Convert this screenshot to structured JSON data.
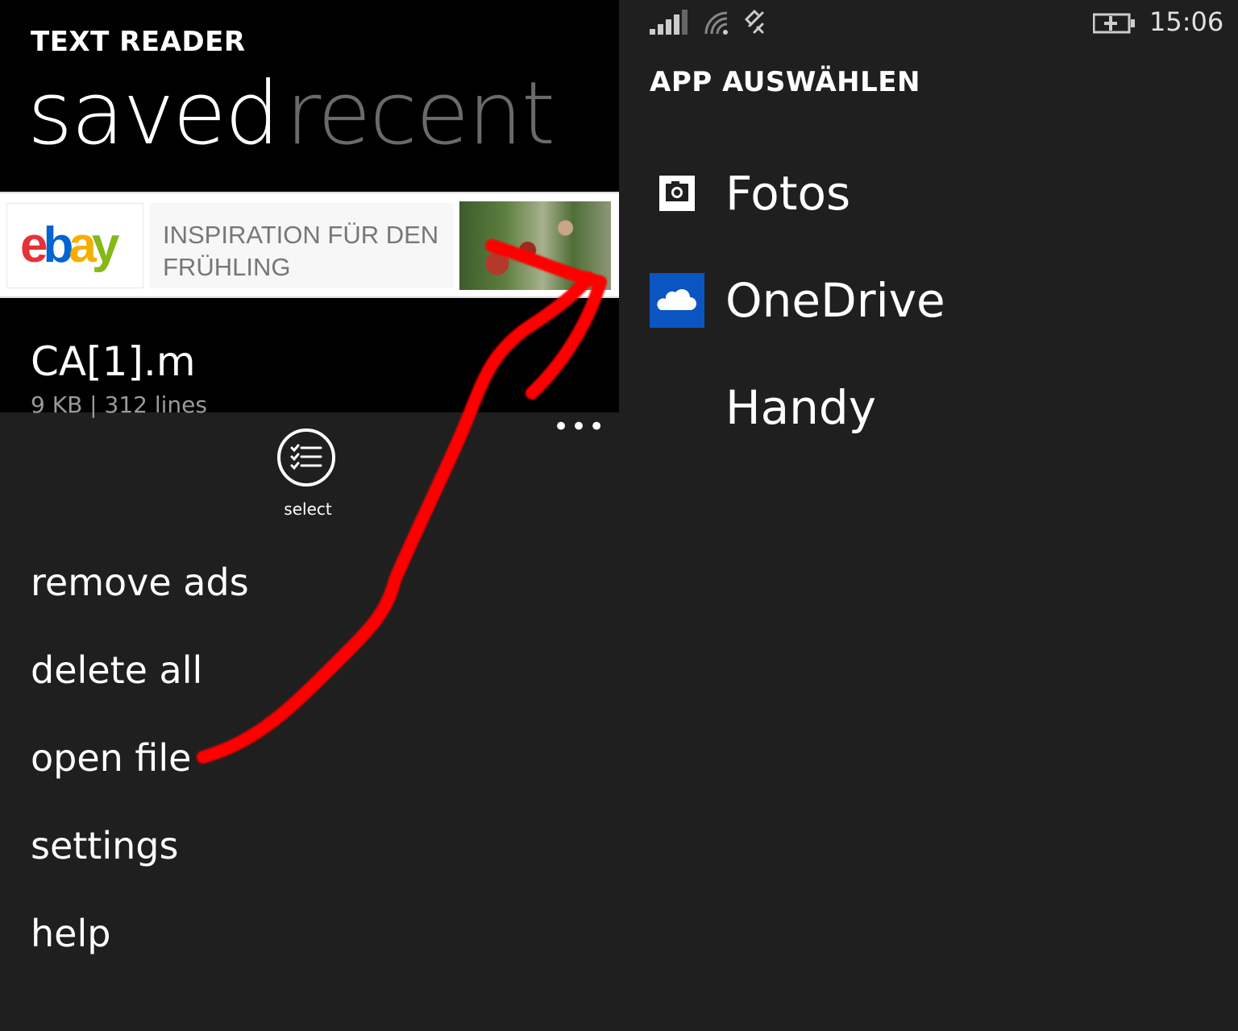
{
  "left_app": {
    "title": "TEXT READER",
    "pivots": {
      "active": "saved",
      "inactive": "recent"
    },
    "ad": {
      "logo": {
        "e": "e",
        "b": "b",
        "a": "a",
        "y": "y"
      },
      "text": "INSPIRATION FÜR DEN FRÜHLING"
    },
    "file": {
      "name": "CA[1].m",
      "meta": "9 KB | 312 lines"
    },
    "appbar": {
      "select_label": "select",
      "more": "•••"
    },
    "menu": [
      "remove ads",
      "delete all",
      "open file",
      "settings",
      "help"
    ]
  },
  "right_app": {
    "status": {
      "time": "15:06"
    },
    "title": "APP AUSWÄHLEN",
    "apps": [
      "Fotos",
      "OneDrive",
      "Handy"
    ]
  },
  "colors": {
    "accent_onedrive": "#0b55c2",
    "annotation_red": "#ff0000",
    "background": "#1f1f1f"
  },
  "icons": [
    "camera-icon",
    "onedrive-cloud-icon",
    "select-list-icon",
    "signal-icon",
    "wifi-icon",
    "flight-mode-icon",
    "battery-charging-icon"
  ]
}
